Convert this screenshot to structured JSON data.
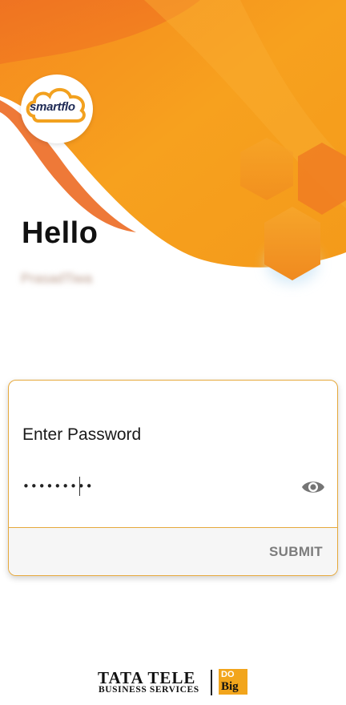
{
  "brand": {
    "app_logo_text": "smartflo",
    "primary_color": "#f7931e",
    "accent_color": "#e6a93c",
    "footer_line1": "TATA TELE",
    "footer_line2": "BUSINESS SERVICES",
    "footer_badge_top": "DO",
    "footer_badge_bottom": "Big"
  },
  "header": {
    "greeting": "Hello",
    "username_blurred": "PrasadTiwa"
  },
  "login_card": {
    "password_label": "Enter Password",
    "password_value": "•••••••••",
    "visibility_icon": "eye-icon",
    "submit_label": "SUBMIT"
  }
}
